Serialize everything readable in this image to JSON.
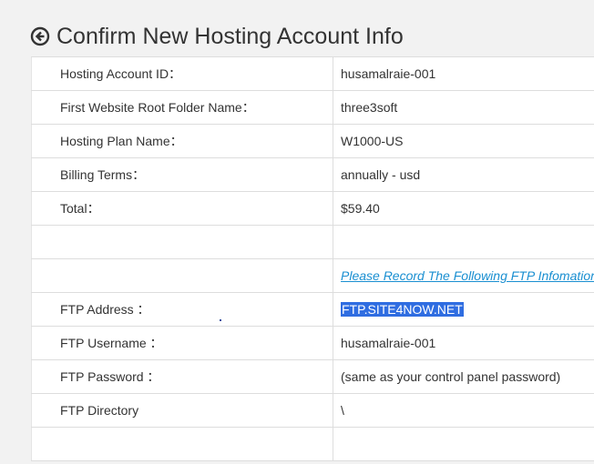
{
  "header": {
    "title": "Confirm New Hosting Account Info",
    "back_icon": "arrow-circle-left-icon"
  },
  "account_rows": [
    {
      "label": "Hosting Account ID：",
      "value": "husamalraie-001"
    },
    {
      "label": "First Website Root Folder Name：",
      "value": "three3soft"
    },
    {
      "label": "Hosting Plan Name：",
      "value": "W1000-US"
    },
    {
      "label": "Billing Terms：",
      "value": "annually - usd"
    },
    {
      "label": "Total：",
      "value": "$59.40"
    }
  ],
  "ftp_notice": "Please Record The Following FTP Infomation:",
  "ftp_rows": [
    {
      "label": "FTP Address ：",
      "value": "FTP.SITE4NOW.NET"
    },
    {
      "label": "FTP Username ：",
      "value": "husamalraie-001"
    },
    {
      "label": "FTP Password ：",
      "value": "(same as your control panel password)"
    },
    {
      "label": "FTP Directory",
      "value": "\\"
    }
  ],
  "colors": {
    "background": "#f2f2f2",
    "link": "#1a8fd1",
    "selection": "#2f6de1"
  }
}
